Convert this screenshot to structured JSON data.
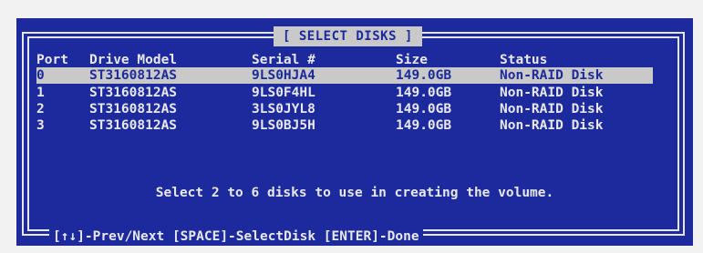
{
  "dialog": {
    "title": "[ SELECT DISKS ]",
    "columns": [
      "Port",
      "Drive Model",
      "Serial #",
      "Size",
      "Status"
    ],
    "rows": [
      {
        "port": "0",
        "model": "ST3160812AS",
        "serial": "9LS0HJA4",
        "size": "149.0GB",
        "status": "Non-RAID Disk",
        "selected": true
      },
      {
        "port": "1",
        "model": "ST3160812AS",
        "serial": "9LS0F4HL",
        "size": "149.0GB",
        "status": "Non-RAID Disk",
        "selected": false
      },
      {
        "port": "2",
        "model": "ST3160812AS",
        "serial": "3LS0JYL8",
        "size": "149.0GB",
        "status": "Non-RAID Disk",
        "selected": false
      },
      {
        "port": "3",
        "model": "ST3160812AS",
        "serial": "9LS0BJ5H",
        "size": "149.0GB",
        "status": "Non-RAID Disk",
        "selected": false
      }
    ],
    "message": "Select 2 to 6 disks to use in creating the volume.",
    "footer": "[↑↓]-Prev/Next [SPACE]-SelectDisk [ENTER]-Done"
  },
  "colors": {
    "background": "#1c2a9e",
    "text": "#e8e8e8",
    "highlight": "#c9c9c9"
  }
}
